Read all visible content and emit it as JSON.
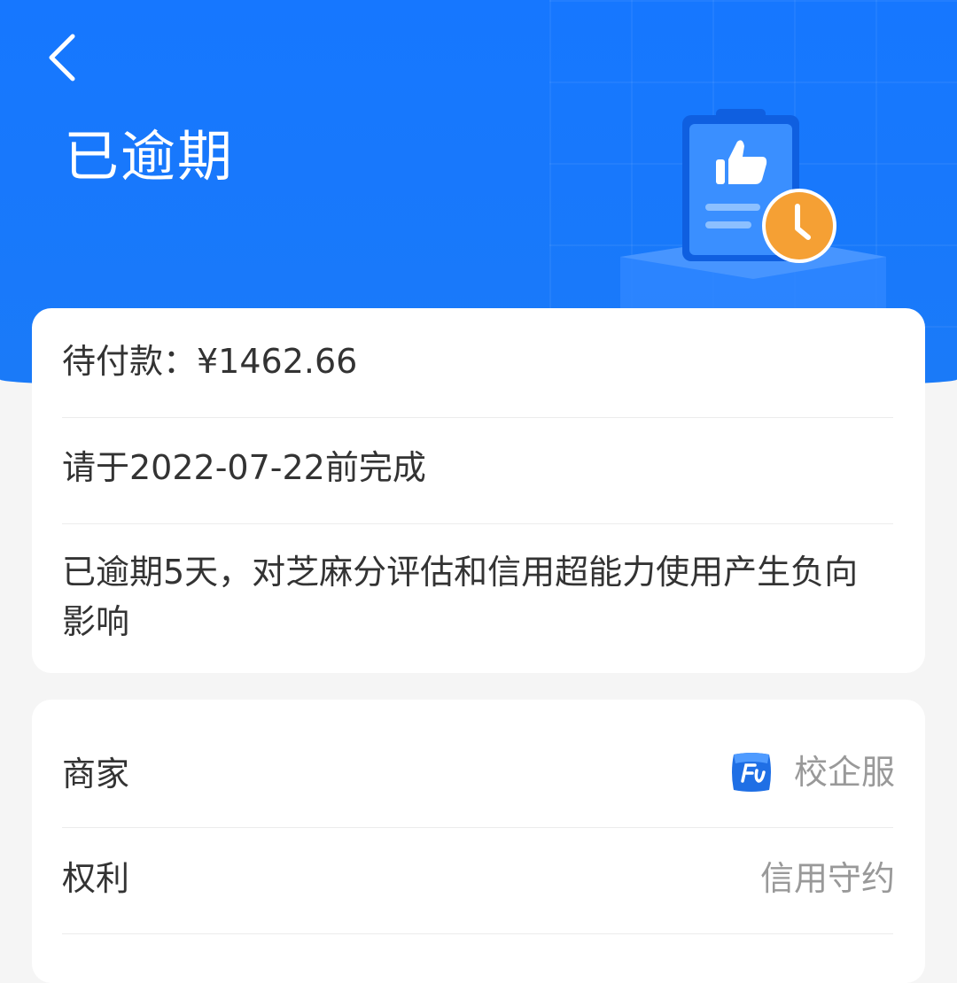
{
  "header": {
    "title": "已逾期",
    "back_icon": "chevron-left-icon",
    "illustration": "clipboard-thumbs-up-clock-illustration",
    "colors": {
      "background": "#1677ff",
      "clock_accent": "#f5a034"
    }
  },
  "payment_card": {
    "amount_line": "待付款：¥1462.66",
    "due_line": "请于2022-07-22前完成",
    "warning_line": "已逾期5天，对芝麻分评估和信用超能力使用产生负向影响"
  },
  "info_card": {
    "rows": [
      {
        "label": "商家",
        "value": "校企服",
        "icon": "merchant-logo-icon"
      },
      {
        "label": "权利",
        "value": "信用守约"
      }
    ]
  }
}
